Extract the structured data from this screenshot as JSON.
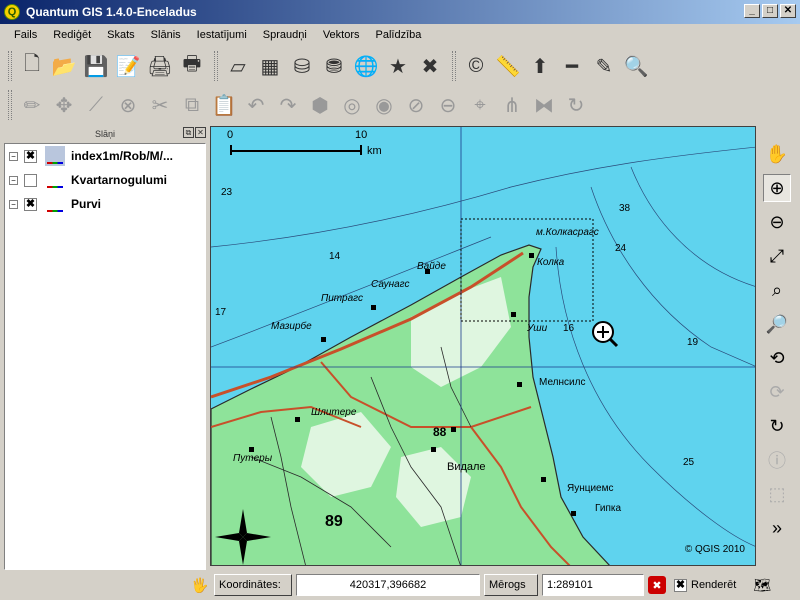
{
  "window": {
    "title": "Quantum GIS 1.4.0-Enceladus",
    "app_icon_letter": "Q",
    "controls": {
      "minimize": "_",
      "maximize": "□",
      "close": "✕"
    }
  },
  "menu": [
    "Fails",
    "Rediģēt",
    "Skats",
    "Slānis",
    "Iestatījumi",
    "Spraudņi",
    "Vektors",
    "Palīdzība"
  ],
  "toolbar_file": [
    {
      "name": "new-project-icon",
      "glyph": "🗋"
    },
    {
      "name": "open-project-icon",
      "glyph": "📂"
    },
    {
      "name": "save-project-icon",
      "glyph": "💾"
    },
    {
      "name": "save-as-icon",
      "glyph": "📝"
    },
    {
      "name": "print-composer-icon",
      "glyph": "🖨"
    },
    {
      "name": "print-icon",
      "glyph": "🖶"
    }
  ],
  "toolbar_layers": [
    {
      "name": "add-vector-layer-icon",
      "glyph": "▱"
    },
    {
      "name": "add-raster-layer-icon",
      "glyph": "▦"
    },
    {
      "name": "add-postgis-layer-icon",
      "glyph": "⛁"
    },
    {
      "name": "add-spatialite-layer-icon",
      "glyph": "⛃"
    },
    {
      "name": "add-wms-layer-icon",
      "glyph": "🌐"
    },
    {
      "name": "new-vector-layer-icon",
      "glyph": "★"
    },
    {
      "name": "remove-layer-icon",
      "glyph": "✖"
    }
  ],
  "toolbar_decor": [
    {
      "name": "copyright-label-icon",
      "glyph": "©"
    },
    {
      "name": "scale-bar-icon",
      "glyph": "📏"
    },
    {
      "name": "north-arrow-icon",
      "glyph": "⬆"
    },
    {
      "name": "measure-line-icon",
      "glyph": "━"
    },
    {
      "name": "measure-area-icon",
      "glyph": "✎"
    },
    {
      "name": "identify-icon",
      "glyph": "🔍"
    }
  ],
  "toolbar_digitize": [
    {
      "name": "toggle-editing-icon",
      "glyph": "✏"
    },
    {
      "name": "capture-point-icon",
      "glyph": "✥"
    },
    {
      "name": "capture-line-icon",
      "glyph": "⟋"
    },
    {
      "name": "delete-selected-icon",
      "glyph": "⊗"
    },
    {
      "name": "cut-features-icon",
      "glyph": "✂"
    },
    {
      "name": "copy-features-icon",
      "glyph": "⧉"
    },
    {
      "name": "paste-features-icon",
      "glyph": "📋"
    },
    {
      "name": "undo-icon",
      "glyph": "↶"
    },
    {
      "name": "redo-icon",
      "glyph": "↷"
    },
    {
      "name": "simplify-feature-icon",
      "glyph": "⬢"
    },
    {
      "name": "add-ring-icon",
      "glyph": "◎"
    },
    {
      "name": "add-island-icon",
      "glyph": "◉"
    },
    {
      "name": "delete-ring-icon",
      "glyph": "⊘"
    },
    {
      "name": "delete-part-icon",
      "glyph": "⊖"
    },
    {
      "name": "reshape-features-icon",
      "glyph": "⌖"
    },
    {
      "name": "split-features-icon",
      "glyph": "⋔"
    },
    {
      "name": "merge-features-icon",
      "glyph": "⧓"
    },
    {
      "name": "rotate-labels-icon",
      "glyph": "↻"
    }
  ],
  "layers_panel": {
    "title": "Slāņi",
    "float_btn": "⧉",
    "close_btn": "✕",
    "items": [
      {
        "label": "index1m/Rob/M/...",
        "checked": "✖",
        "expander": "−"
      },
      {
        "label": "Kvartarnogulumi",
        "checked": "",
        "expander": "−"
      },
      {
        "label": "Purvi",
        "checked": "✖",
        "expander": "−"
      }
    ]
  },
  "map": {
    "scalebar": {
      "start": "0",
      "end": "10",
      "unit": "km"
    },
    "copyright": "© QGIS 2010",
    "labels": {
      "kolka": "Колка",
      "kolkasrags": "м.Колкасрагс",
      "vaide": "Вайде",
      "saunags": "Саунагс",
      "pitrags": "Питрагс",
      "mazirbe": "Мазирбе",
      "melnsils": "Мелнсилс",
      "usi": "Уши",
      "vidale": "Видале",
      "jaunciems": "Яунциемс",
      "gipka": "Гипка",
      "sliktere": "Шлитере",
      "pape": "Путеры",
      "depth_23": "23",
      "depth_14": "14",
      "depth_16": "16",
      "depth_19": "19",
      "depth_24": "24",
      "depth_25": "25",
      "depth_38": "38",
      "depth_88": "88",
      "depth_89": "89",
      "depth_17": "17"
    }
  },
  "nav_toolbar": [
    {
      "name": "pan-icon",
      "glyph": "✋",
      "state": "normal"
    },
    {
      "name": "zoom-in-icon",
      "glyph": "⊕",
      "state": "active"
    },
    {
      "name": "zoom-out-icon",
      "glyph": "⊖",
      "state": "normal"
    },
    {
      "name": "zoom-full-icon",
      "glyph": "⤢",
      "state": "normal"
    },
    {
      "name": "zoom-to-selection-icon",
      "glyph": "⌕",
      "state": "normal"
    },
    {
      "name": "zoom-to-layer-icon",
      "glyph": "🔎",
      "state": "normal"
    },
    {
      "name": "zoom-last-icon",
      "glyph": "⟲",
      "state": "normal"
    },
    {
      "name": "zoom-next-icon",
      "glyph": "⟳",
      "state": "disabled"
    },
    {
      "name": "refresh-icon",
      "glyph": "↻",
      "state": "normal"
    },
    {
      "name": "identify-features-icon",
      "glyph": "ⓘ",
      "state": "disabled"
    },
    {
      "name": "select-features-icon",
      "glyph": "⬚",
      "state": "disabled"
    },
    {
      "name": "more-tools-icon",
      "glyph": "»",
      "state": "normal"
    }
  ],
  "statusbar": {
    "coords_label": "Koordinātes:",
    "coords_value": "420317,396682",
    "scale_label": "Mērogs",
    "scale_value": "1:289101",
    "stop_glyph": "✖",
    "render_check": "✖",
    "render_label": "Renderēt"
  },
  "colors": {
    "sea": "#5fd3ee",
    "land": "#8ee39a",
    "forest": "#7fd88c",
    "road": "#c8502a",
    "contour": "#6a4a2a"
  }
}
